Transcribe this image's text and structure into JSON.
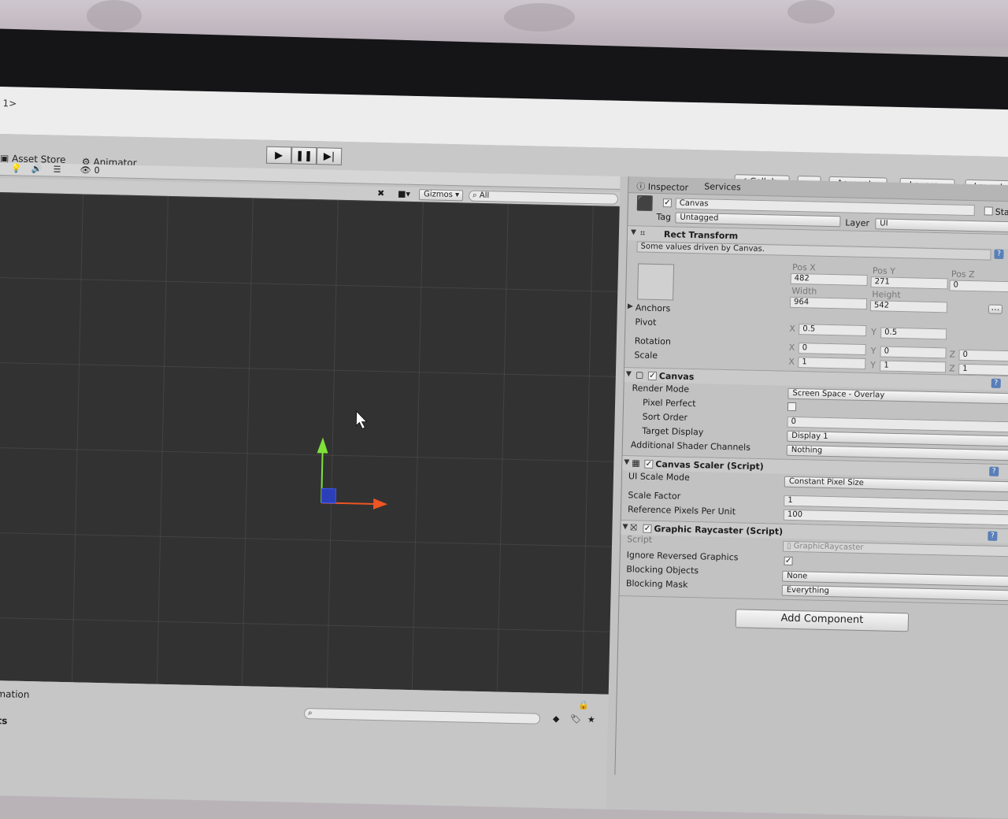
{
  "window": {
    "title": "1>"
  },
  "tabs": {
    "asset_store": "Asset Store",
    "animator": "Animator"
  },
  "scene_toolbar": {
    "gizmos": "Gizmos",
    "search_placeholder": "All",
    "count": "0"
  },
  "top_buttons": {
    "collab": "Collab",
    "account": "Account",
    "layers": "Layers",
    "layout": "Layout"
  },
  "inspector": {
    "tab_inspector": "Inspector",
    "tab_services": "Services",
    "object_name": "Canvas",
    "static_label": "Sta",
    "tag_label": "Tag",
    "tag_value": "Untagged",
    "layer_label": "Layer",
    "layer_value": "UI",
    "rect_transform": {
      "title": "Rect Transform",
      "note": "Some values driven by Canvas.",
      "pos_x_label": "Pos X",
      "pos_y_label": "Pos Y",
      "pos_z_label": "Pos Z",
      "pos_x": "482",
      "pos_y": "271",
      "pos_z": "0",
      "width_label": "Width",
      "height_label": "Height",
      "width": "964",
      "height": "542",
      "anchors_label": "Anchors",
      "pivot_label": "Pivot",
      "pivot_x": "0.5",
      "pivot_y": "0.5",
      "rotation_label": "Rotation",
      "rot_x": "0",
      "rot_y": "0",
      "rot_z": "0",
      "scale_label": "Scale",
      "scale_x": "1",
      "scale_y": "1",
      "scale_z": "1",
      "x": "X",
      "y": "Y",
      "z": "Z"
    },
    "canvas": {
      "title": "Canvas",
      "render_mode_label": "Render Mode",
      "render_mode": "Screen Space - Overlay",
      "pixel_perfect_label": "Pixel Perfect",
      "sort_order_label": "Sort Order",
      "sort_order": "0",
      "target_display_label": "Target Display",
      "target_display": "Display 1",
      "shader_channels_label": "Additional Shader Channels",
      "shader_channels": "Nothing"
    },
    "canvas_scaler": {
      "title": "Canvas Scaler (Script)",
      "ui_scale_mode_label": "UI Scale Mode",
      "ui_scale_mode": "Constant Pixel Size",
      "scale_factor_label": "Scale Factor",
      "scale_factor": "1",
      "ref_ppu_label": "Reference Pixels Per Unit",
      "ref_ppu": "100"
    },
    "graphic_raycaster": {
      "title": "Graphic Raycaster (Script)",
      "script_label": "Script",
      "script": "GraphicRaycaster",
      "ignore_reversed_label": "Ignore Reversed Graphics",
      "blocking_objects_label": "Blocking Objects",
      "blocking_objects": "None",
      "blocking_mask_label": "Blocking Mask",
      "blocking_mask": "Everything"
    },
    "add_component": "Add Component"
  },
  "bottom": {
    "animation_tab": "nimation",
    "scripts_label": "ipts"
  }
}
